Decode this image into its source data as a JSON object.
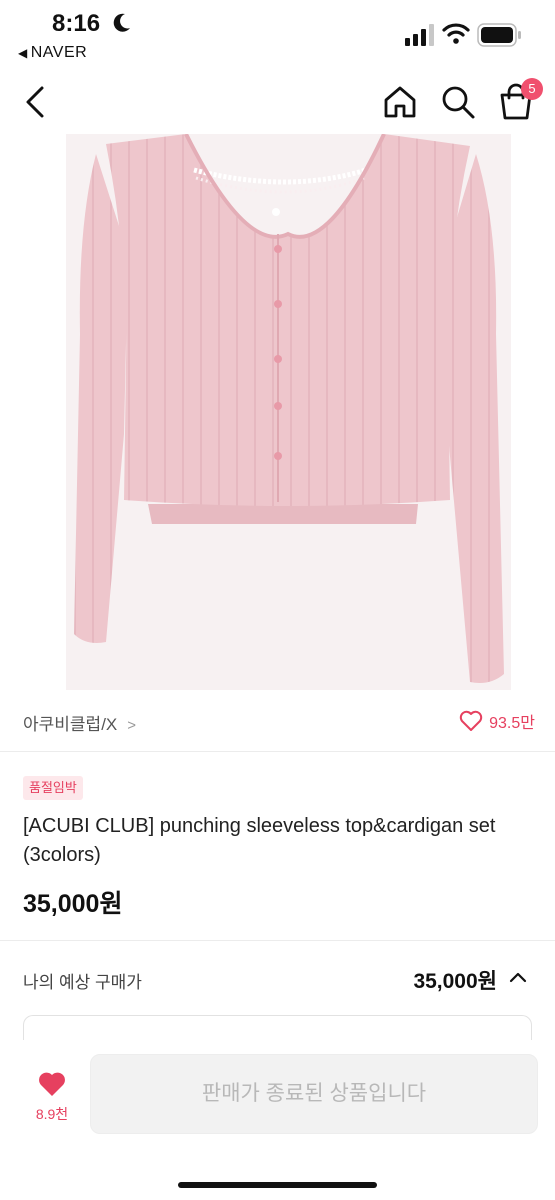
{
  "status_bar": {
    "time": "8:16",
    "back_app": "NAVER"
  },
  "nav": {
    "cart_count": "5",
    "icons": [
      "back-chevron-icon",
      "home-icon",
      "search-icon",
      "shopping-bag-icon"
    ]
  },
  "product": {
    "store": "아쿠비클럽/X",
    "store_chevron": ">",
    "likes": "93.5만",
    "status_badge": "품절임박",
    "title": "[ACUBI CLUB] punching sleeveless top&cardigan set (3colors)",
    "price": "35,000원"
  },
  "expected": {
    "label": "나의 예상 구매가",
    "price": "35,000원"
  },
  "bottom": {
    "wish_count": "8.9천",
    "cta": "판매가 종료된 상품입니다"
  },
  "colors": {
    "accent": "#e6405f",
    "badge_bg": "#fde8eb",
    "garment": "#eec6cc",
    "disabled_btn": "#f2f2f2"
  }
}
